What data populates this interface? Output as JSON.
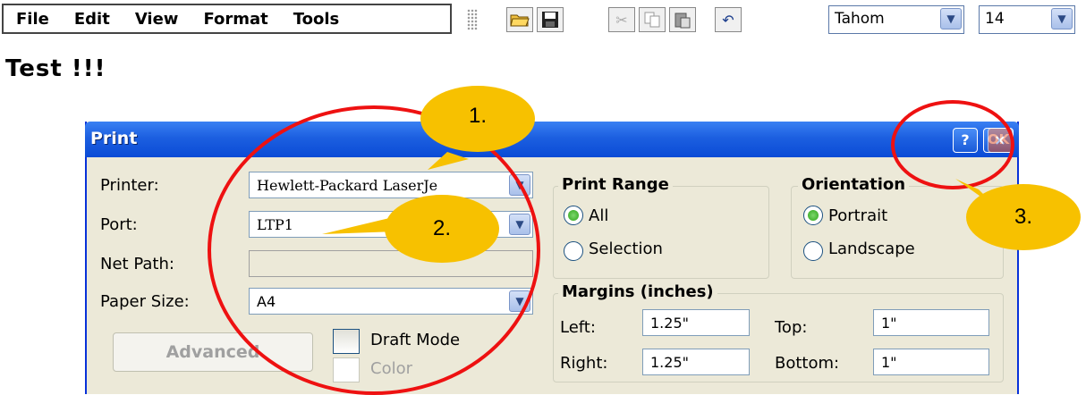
{
  "menu": [
    "File",
    "Edit",
    "View",
    "Format",
    "Tools"
  ],
  "toolbar": {
    "icons": [
      "open-folder-icon",
      "save-icon",
      "cut-icon",
      "copy-icon",
      "paste-icon",
      "undo-icon"
    ],
    "font_name": "Tahom",
    "font_size": "14"
  },
  "document_text": "Test !!!",
  "dialog": {
    "title": "Print",
    "help_label": "?",
    "ok_label": "OK",
    "close_label": "×",
    "printer_label": "Printer:",
    "printer_value": "Hewlett-Packard LaserJe",
    "port_label": "Port:",
    "port_value": "LTP1",
    "netpath_label": "Net Path:",
    "netpath_value": "",
    "papersize_label": "Paper Size:",
    "papersize_value": "A4",
    "advanced_label": "Advanced",
    "draft_label": "Draft Mode",
    "color_label": "Color",
    "print_range": {
      "title": "Print Range",
      "all_label": "All",
      "selection_label": "Selection",
      "selected": "All"
    },
    "orientation": {
      "title": "Orientation",
      "portrait_label": "Portrait",
      "landscape_label": "Landscape",
      "selected": "Portrait"
    },
    "margins": {
      "title": "Margins (inches)",
      "left_label": "Left:",
      "left_value": "1.25\"",
      "right_label": "Right:",
      "right_value": "1.25\"",
      "top_label": "Top:",
      "top_value": "1\"",
      "bottom_label": "Bottom:",
      "bottom_value": "1\""
    }
  },
  "annotations": [
    "1.",
    "2.",
    "3."
  ],
  "colors": {
    "title_blue": "#0a4bd6",
    "ring_red": "#e11111",
    "bubble_yellow": "#f7c100",
    "dialog_bg": "#ece9d8"
  }
}
